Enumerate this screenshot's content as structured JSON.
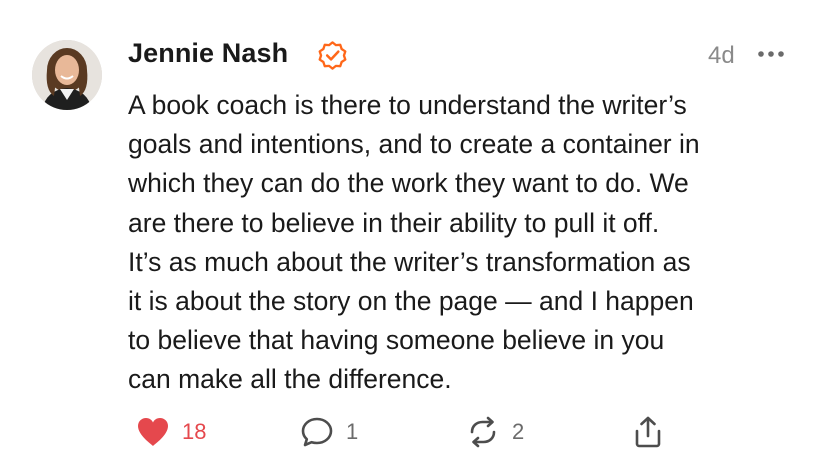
{
  "note": {
    "author": {
      "name": "Jennie Nash",
      "verified": true,
      "verified_icon": "verified-check-icon",
      "avatar": "author-avatar-photo"
    },
    "timestamp": "4d",
    "more_icon": "more-dots-icon",
    "body": "A book coach is there to understand the writer’s\ngoals and intentions, and to create a container in\nwhich they can do the work they want to do. We\nare there to believe in their ability to pull it off.\nIt’s as much about the writer’s transformation as\nit is about the story on the page — and I happen\nto believe that having someone believe in you\ncan make all the difference.",
    "actions": {
      "likes": {
        "icon": "heart-icon",
        "count": "18",
        "liked": true
      },
      "comments": {
        "icon": "comment-icon",
        "count": "1"
      },
      "restacks": {
        "icon": "restack-icon",
        "count": "2"
      },
      "share": {
        "icon": "share-icon"
      }
    },
    "colors": {
      "accent": "#ff6719",
      "like": "#e5484d",
      "muted": "#8a8a8a",
      "text": "#1a1a1a"
    }
  }
}
